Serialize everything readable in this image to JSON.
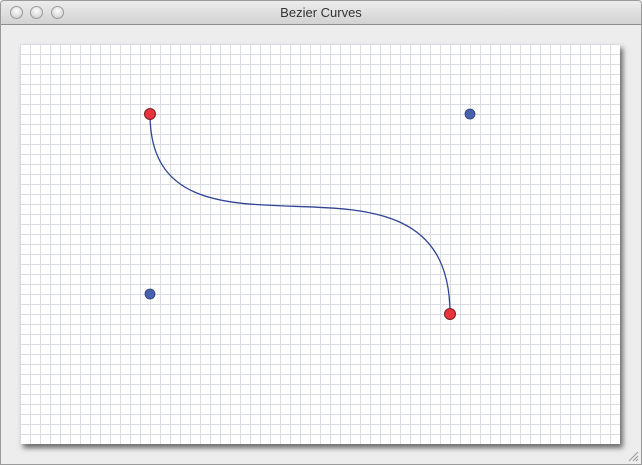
{
  "window": {
    "title": "Bezier Curves"
  },
  "icons": {
    "close": "close-icon",
    "minimize": "minimize-icon",
    "zoom": "zoom-icon",
    "resize": "resize-grip-icon"
  },
  "colors": {
    "grid_line": "#d9dde3",
    "curve": "#2f4594",
    "endpoint_fill": "#e8333d",
    "endpoint_stroke": "#7a1f26",
    "control_fill": "#4a62ad",
    "control_stroke": "#2b3d78"
  }
}
